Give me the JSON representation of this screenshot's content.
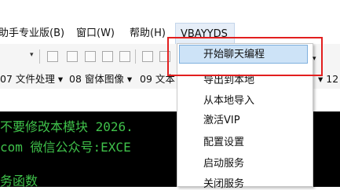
{
  "menubar": {
    "items": [
      {
        "label": "助手专业版(B)"
      },
      {
        "label": "窗口(W)"
      },
      {
        "label": "帮助(H)"
      },
      {
        "label": "VBAYYDS"
      }
    ]
  },
  "toolbar2": {
    "items": [
      {
        "label": "07 文件处理 ▾"
      },
      {
        "label": "08 窗体图像 ▾"
      },
      {
        "label": "09 文本"
      },
      {
        "label": "▾ 12"
      }
    ]
  },
  "dropdown": {
    "items": [
      {
        "label": "开始聊天编程"
      },
      {
        "label": "导出到本地"
      },
      {
        "label": "从本地导入"
      },
      {
        "label": "激活VIP"
      },
      {
        "label": "配置设置"
      },
      {
        "label": "启动服务"
      },
      {
        "label": "关闭服务"
      }
    ]
  },
  "editor": {
    "lines": [
      {
        "text": "不要修改本模块 2026."
      },
      {
        "text": "com 微信公众号:EXCE"
      },
      {
        "text": "务函数"
      }
    ]
  },
  "colors": {
    "highlight_border": "#e21f1f",
    "selected_item_bg": "#cde3f7",
    "code_text": "#3fc14a"
  }
}
